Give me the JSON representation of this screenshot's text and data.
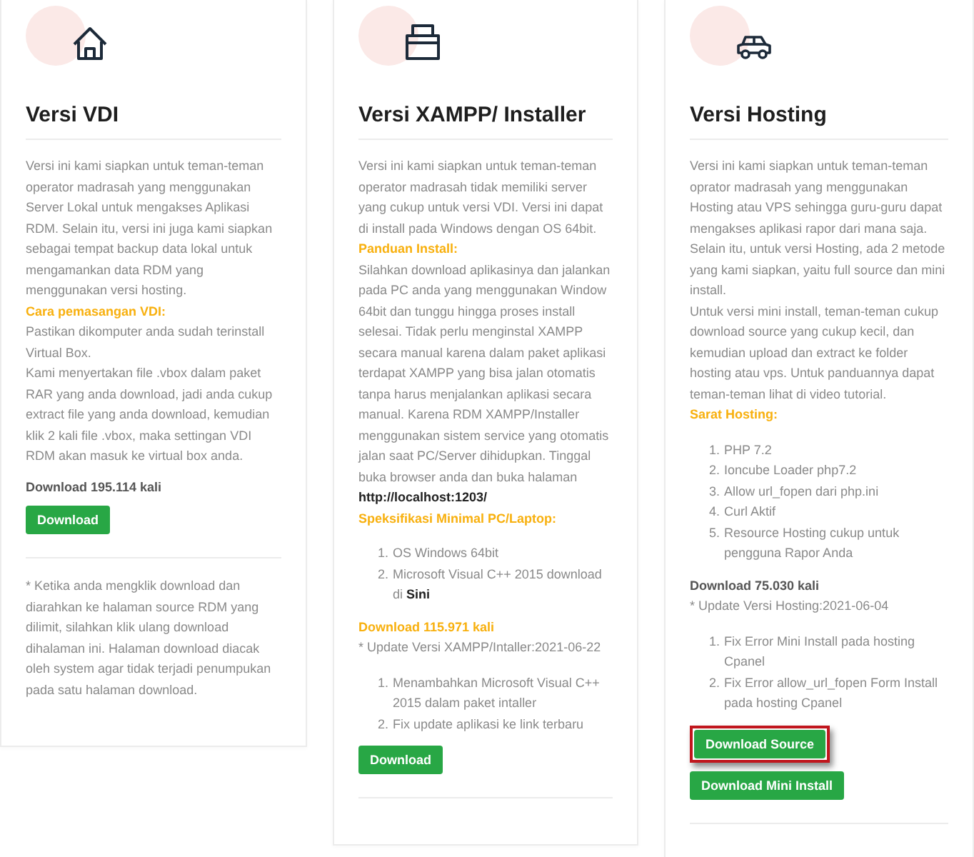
{
  "cards": [
    {
      "title": "Versi VDI",
      "blocks": [
        {
          "kind": "paragraph",
          "text": "Versi ini kami siapkan untuk teman-teman operator madrasah yang menggunakan Server Lokal untuk mengakses Aplikasi RDM. Selain itu, versi ini juga kami siapkan sebagai tempat backup data lokal untuk mengamankan data RDM yang menggunakan versi hosting."
        },
        {
          "kind": "heading",
          "text": "Cara pemasangan VDI:"
        },
        {
          "kind": "paragraph",
          "text": "Pastikan dikomputer anda sudah terinstall Virtual Box."
        },
        {
          "kind": "paragraph",
          "text": "Kami menyertakan file .vbox dalam paket RAR yang anda download, jadi anda cukup extract file yang anda download, kemudian klik 2 kali file .vbox, maka settingan VDI RDM akan masuk ke virtual box anda."
        },
        {
          "kind": "count",
          "text": "Download 195.114 kali",
          "accent": false
        },
        {
          "kind": "button",
          "label": "Download",
          "highlighted": false
        },
        {
          "kind": "divider"
        },
        {
          "kind": "note",
          "text": "* Ketika anda mengklik download dan diarahkan ke halaman source RDM yang dilimit, silahkan klik ulang download dihalaman ini. Halaman download diacak oleh system agar tidak terjadi penumpukan pada satu halaman download."
        }
      ]
    },
    {
      "title": "Versi XAMPP/ Installer",
      "blocks": [
        {
          "kind": "paragraph",
          "text": "Versi ini kami siapkan untuk teman-teman operator madrasah tidak memiliki server yang cukup untuk versi VDI. Versi ini dapat di install pada Windows dengan OS 64bit."
        },
        {
          "kind": "heading",
          "text": "Panduan Install:"
        },
        {
          "kind": "paragraph",
          "text": "Silahkan download aplikasinya dan jalankan pada PC anda yang menggunakan Window 64bit dan tunggu hingga proses install selesai. Tidak perlu menginstal XAMPP secara manual karena dalam paket aplikasi terdapat XAMPP yang bisa jalan otomatis tanpa harus menjalankan aplikasi secara manual. Karena RDM XAMPP/Installer menggunakan sistem service yang otomatis jalan saat PC/Server dihidupkan. Tinggal buka browser anda dan buka halaman **http://localhost:1203/**"
        },
        {
          "kind": "heading",
          "text": "Speksifikasi Minimal PC/Laptop:"
        },
        {
          "kind": "list",
          "items": [
            {
              "marker": "1.",
              "text": "OS Windows 64bit"
            },
            {
              "marker": "2.",
              "text": "Microsoft Visual C++ 2015 download di **Sini**"
            }
          ]
        },
        {
          "kind": "count",
          "text": "Download 115.971 kali",
          "accent": true
        },
        {
          "kind": "paragraph",
          "text": "* Update Versi XAMPP/Intaller:2021-06-22"
        },
        {
          "kind": "list",
          "items": [
            {
              "marker": "1.",
              "text": "Menambahkan Microsoft Visual C++ 2015 dalam paket intaller"
            },
            {
              "marker": "2.",
              "text": "Fix update aplikasi ke link terbaru"
            }
          ]
        },
        {
          "kind": "button",
          "label": "Download",
          "highlighted": false
        },
        {
          "kind": "divider"
        }
      ]
    },
    {
      "title": "Versi Hosting",
      "blocks": [
        {
          "kind": "paragraph",
          "text": "Versi ini kami siapkan untuk teman-teman oprator madrasah yang menggunakan Hosting atau VPS sehingga guru-guru dapat mengakses aplikasi rapor dari mana saja."
        },
        {
          "kind": "paragraph",
          "text": "Selain itu, untuk versi Hosting, ada 2 metode yang kami siapkan, yaitu full source dan mini install."
        },
        {
          "kind": "paragraph",
          "text": "Untuk versi mini install, teman-teman cukup download source yang cukup kecil, dan kemudian upload dan extract ke folder hosting atau vps. Untuk panduannya dapat teman-teman lihat di video tutorial."
        },
        {
          "kind": "heading",
          "text": "Sarat Hosting:"
        },
        {
          "kind": "list",
          "items": [
            {
              "marker": "1.",
              "text": "PHP 7.2"
            },
            {
              "marker": "2.",
              "text": "Ioncube Loader php7.2"
            },
            {
              "marker": "3.",
              "text": "Allow url_fopen dari php.ini"
            },
            {
              "marker": "4.",
              "text": "Curl Aktif"
            },
            {
              "marker": "5.",
              "text": "Resource Hosting cukup untuk pengguna Rapor Anda"
            }
          ]
        },
        {
          "kind": "count",
          "text": "Download 75.030 kali",
          "accent": false
        },
        {
          "kind": "paragraph",
          "text": "* Update Versi Hosting:2021-06-04"
        },
        {
          "kind": "list",
          "items": [
            {
              "marker": "1.",
              "text": "Fix Error Mini Install pada hosting Cpanel"
            },
            {
              "marker": "2.",
              "text": "Fix Error allow_url_fopen Form Install pada hosting Cpanel"
            }
          ]
        },
        {
          "kind": "button",
          "label": "Download Source",
          "highlighted": true
        },
        {
          "kind": "button",
          "label": "Download Mini Install",
          "highlighted": false
        },
        {
          "kind": "divider"
        }
      ]
    }
  ]
}
